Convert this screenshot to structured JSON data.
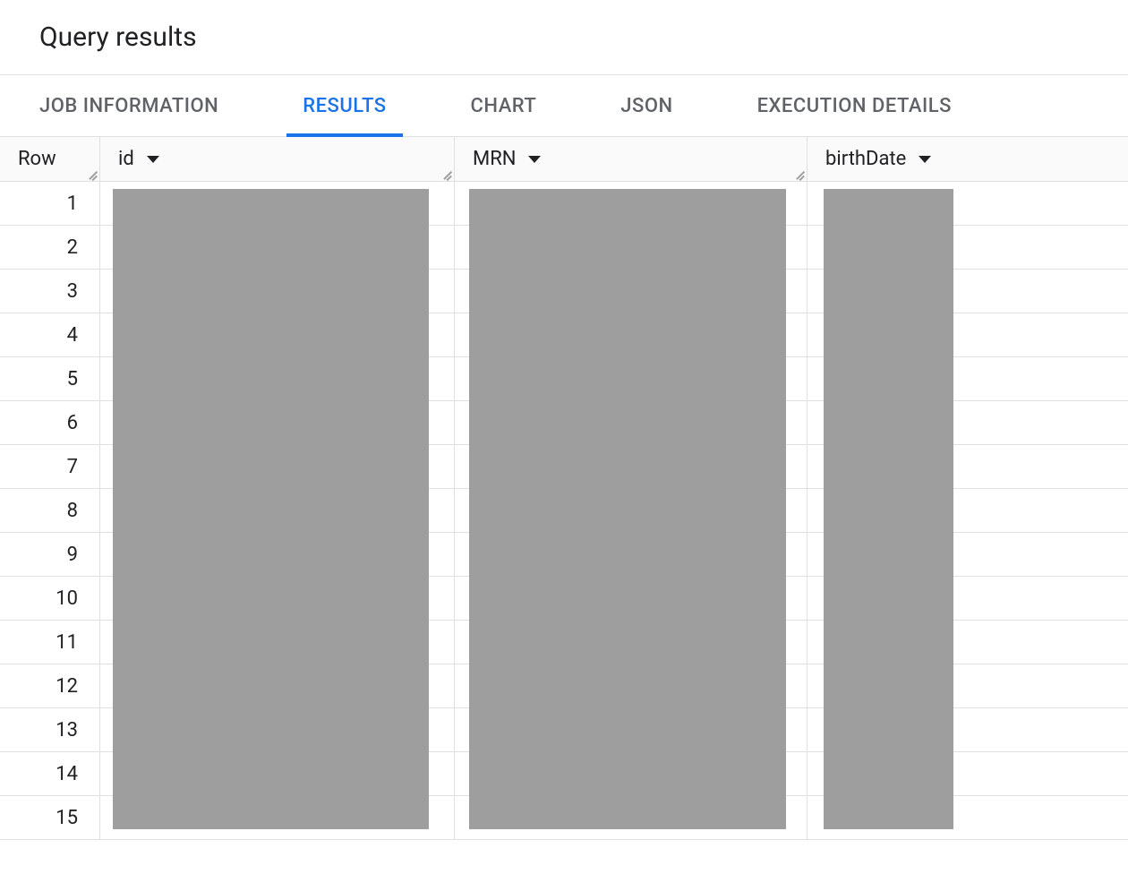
{
  "header": {
    "title": "Query results"
  },
  "tabs": [
    {
      "label": "JOB INFORMATION",
      "active": false
    },
    {
      "label": "RESULTS",
      "active": true
    },
    {
      "label": "CHART",
      "active": false
    },
    {
      "label": "JSON",
      "active": false
    },
    {
      "label": "EXECUTION DETAILS",
      "active": false
    }
  ],
  "table": {
    "columns": [
      {
        "key": "row",
        "label": "Row"
      },
      {
        "key": "id",
        "label": "id"
      },
      {
        "key": "mrn",
        "label": "MRN"
      },
      {
        "key": "birthdate",
        "label": "birthDate"
      }
    ],
    "rows": [
      {
        "num": "1"
      },
      {
        "num": "2"
      },
      {
        "num": "3"
      },
      {
        "num": "4"
      },
      {
        "num": "5"
      },
      {
        "num": "6"
      },
      {
        "num": "7"
      },
      {
        "num": "8"
      },
      {
        "num": "9"
      },
      {
        "num": "10"
      },
      {
        "num": "11"
      },
      {
        "num": "12"
      },
      {
        "num": "13"
      },
      {
        "num": "14"
      },
      {
        "num": "15"
      }
    ]
  }
}
